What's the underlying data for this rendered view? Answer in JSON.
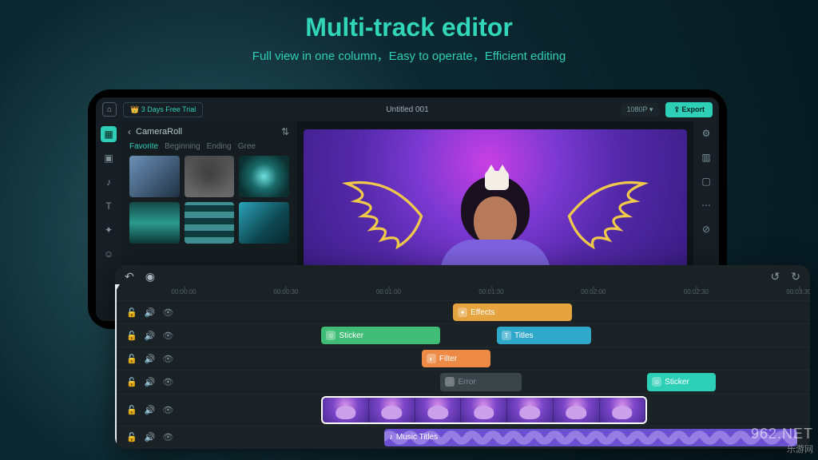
{
  "hero": {
    "title": "Multi-track editor",
    "subtitle": "Full view in one column，Easy to operate，Efficient editing"
  },
  "topbar": {
    "trial": "3 Days Free Trial",
    "project": "Untitled 001",
    "resolution": "1080P",
    "export": "Export"
  },
  "media": {
    "back": "‹",
    "folder": "CameraRoll",
    "tabs": [
      "Favorite",
      "Beginning",
      "Ending",
      "Gree"
    ]
  },
  "ruler": [
    "00:00:00",
    "00:00:30",
    "00:01:00",
    "00:01:30",
    "00:02:00",
    "00:02:30",
    "00:03:30"
  ],
  "timeline": {
    "row0": {
      "effects": "Effects"
    },
    "row1": {
      "sticker": "Sticker",
      "titles": "Titles"
    },
    "row2": {
      "filter": "Filter"
    },
    "row3": {
      "error": "Error",
      "sticker": "Sticker"
    },
    "row5": {
      "music": "Music Titles"
    }
  },
  "watermark": {
    "main": "962.NET",
    "sub": "乐游网"
  }
}
